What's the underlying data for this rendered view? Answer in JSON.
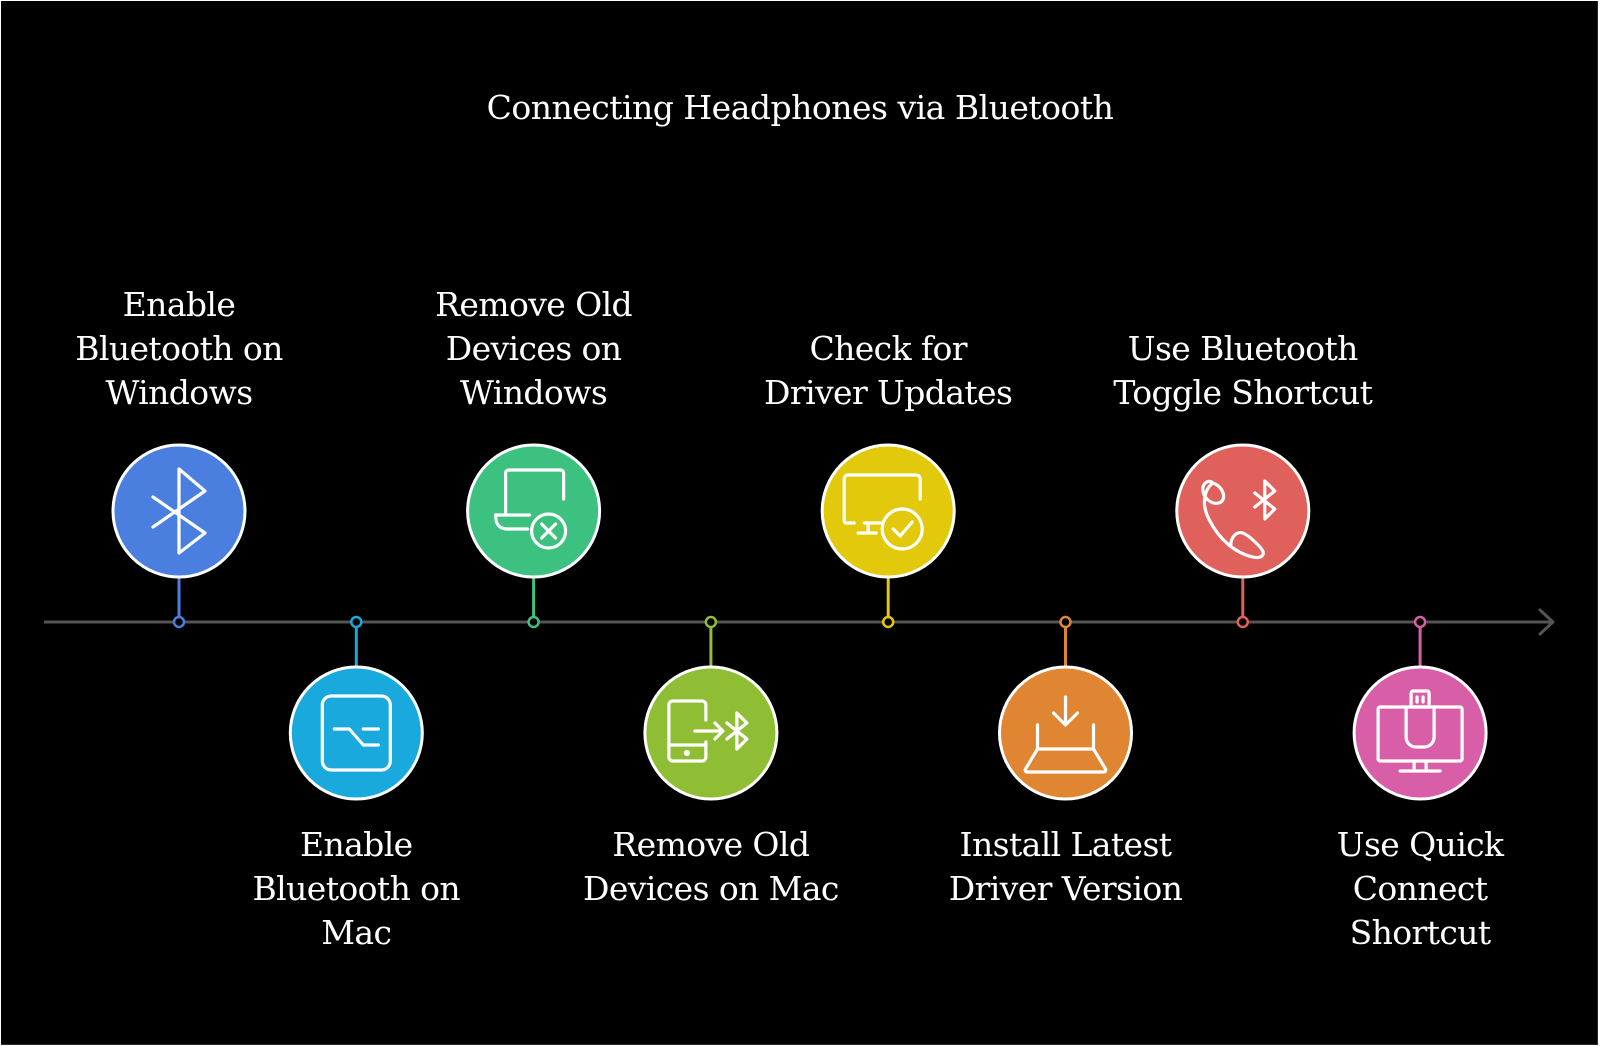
{
  "title": "Connecting Headphones via Bluetooth",
  "timeline": {
    "line_color": "#555555",
    "arrow_icon": "arrow-right-icon"
  },
  "steps": [
    {
      "label": "Enable Bluetooth on Windows",
      "lines": [
        "Enable",
        "Bluetooth on",
        "Windows"
      ],
      "icon": "bluetooth-icon",
      "color": "#4a7fe0",
      "position": "top"
    },
    {
      "label": "Enable Bluetooth on Mac",
      "lines": [
        "Enable",
        "Bluetooth on",
        "Mac"
      ],
      "icon": "toggle-switch-icon",
      "color": "#1aa9dd",
      "position": "bottom"
    },
    {
      "label": "Remove Old Devices on Windows",
      "lines": [
        "Remove Old",
        "Devices on",
        "Windows"
      ],
      "icon": "laptop-remove-icon",
      "color": "#3cc180",
      "position": "top"
    },
    {
      "label": "Remove Old Devices on Mac",
      "lines": [
        "Remove Old",
        "Devices on Mac"
      ],
      "icon": "phone-bluetooth-transfer-icon",
      "color": "#8fbe34",
      "position": "bottom"
    },
    {
      "label": "Check for Driver Updates",
      "lines": [
        "Check for",
        "Driver Updates"
      ],
      "icon": "monitor-check-icon",
      "color": "#e2c90b",
      "position": "top"
    },
    {
      "label": "Install Latest Driver Version",
      "lines": [
        "Install Latest",
        "Driver Version"
      ],
      "icon": "laptop-download-icon",
      "color": "#e08632",
      "position": "bottom"
    },
    {
      "label": "Use Bluetooth Toggle Shortcut",
      "lines": [
        "Use Bluetooth",
        "Toggle Shortcut"
      ],
      "icon": "phone-bluetooth-icon",
      "color": "#e0605c",
      "position": "top"
    },
    {
      "label": "Use Quick Connect Shortcut",
      "lines": [
        "Use Quick",
        "Connect",
        "Shortcut"
      ],
      "icon": "usb-monitor-icon",
      "color": "#d95ea8",
      "position": "bottom"
    }
  ]
}
